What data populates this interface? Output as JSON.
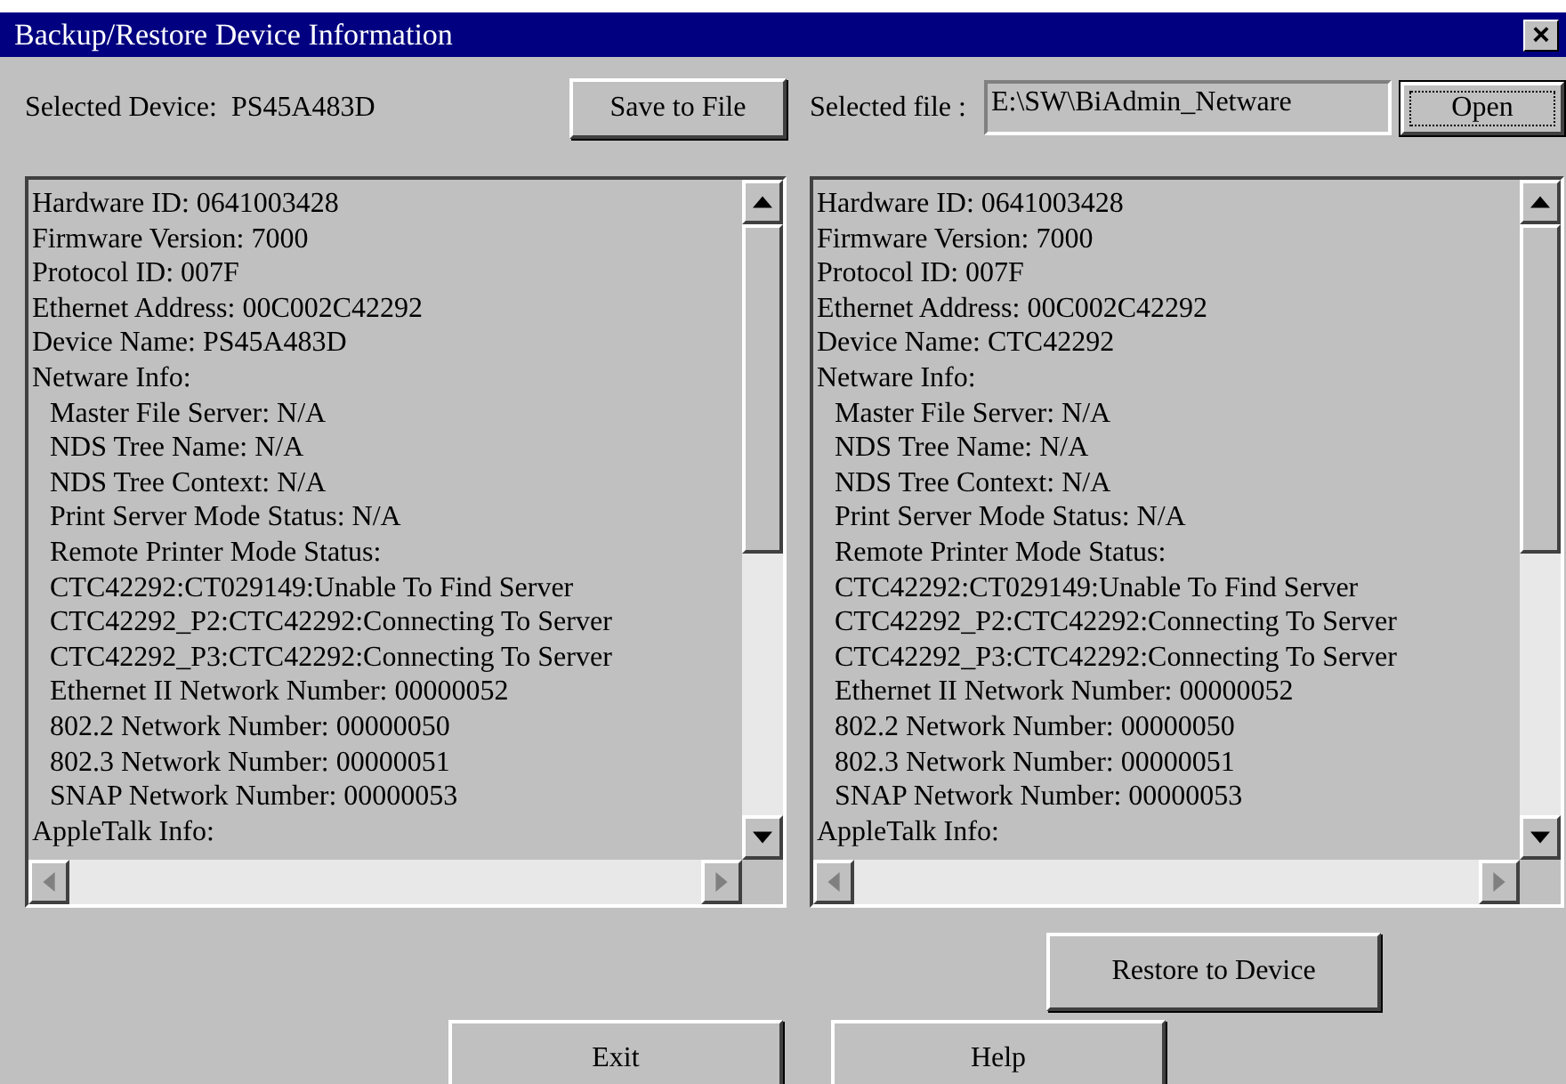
{
  "window": {
    "title": "Backup/Restore Device Information",
    "close": "×"
  },
  "device": {
    "label": "Selected Device:",
    "value": "PS45A483D",
    "button": "Save to File"
  },
  "file": {
    "label": "Selected file :",
    "value": "E:\\SW\\BiAdmin_Netware",
    "button": "Open"
  },
  "panels": [
    {
      "lines": [
        {
          "text": "Hardware ID: 0641003428"
        },
        {
          "text": "Firmware Version: 7000"
        },
        {
          "text": "Protocol ID: 007F"
        },
        {
          "text": "Ethernet Address: 00C002C42292"
        },
        {
          "text": "Device Name: PS45A483D"
        },
        {
          "text": "Netware Info:",
          "children": [
            {
              "text": "Master File Server: N/A"
            },
            {
              "text": "NDS Tree Name: N/A"
            },
            {
              "text": "NDS Tree Context: N/A"
            },
            {
              "text": "Print Server Mode Status: N/A"
            },
            {
              "text": "Remote Printer Mode Status:"
            },
            {
              "text": "CTC42292:CT029149:Unable To Find Server"
            },
            {
              "text": "CTC42292_P2:CTC42292:Connecting To Server"
            },
            {
              "text": "CTC42292_P3:CTC42292:Connecting To Server"
            },
            {
              "text": "Ethernet II Network Number: 00000052"
            },
            {
              "text": "802.2 Network Number: 00000050"
            },
            {
              "text": "802.3 Network Number: 00000051"
            },
            {
              "text": "SNAP Network Number: 00000053"
            }
          ]
        },
        {
          "text": "AppleTalk Info:"
        }
      ]
    },
    {
      "lines": [
        {
          "text": "Hardware ID: 0641003428"
        },
        {
          "text": "Firmware Version: 7000"
        },
        {
          "text": "Protocol ID: 007F"
        },
        {
          "text": "Ethernet Address: 00C002C42292"
        },
        {
          "text": "Device Name: CTC42292"
        },
        {
          "text": "Netware Info:",
          "children": [
            {
              "text": "Master File Server: N/A"
            },
            {
              "text": "NDS Tree Name: N/A"
            },
            {
              "text": "NDS Tree Context: N/A"
            },
            {
              "text": "Print Server Mode Status: N/A"
            },
            {
              "text": "Remote Printer Mode Status:"
            },
            {
              "text": "CTC42292:CT029149:Unable To Find Server"
            },
            {
              "text": "CTC42292_P2:CTC42292:Connecting To Server"
            },
            {
              "text": "CTC42292_P3:CTC42292:Connecting To Server"
            },
            {
              "text": "Ethernet II Network Number: 00000052"
            },
            {
              "text": "802.2 Network Number: 00000050"
            },
            {
              "text": "802.3 Network Number: 00000051"
            },
            {
              "text": "SNAP Network Number: 00000053"
            }
          ]
        },
        {
          "text": "AppleTalk Info:"
        }
      ]
    }
  ],
  "restore_button": "Restore to Device",
  "buttons": [
    "Exit",
    "Help"
  ]
}
